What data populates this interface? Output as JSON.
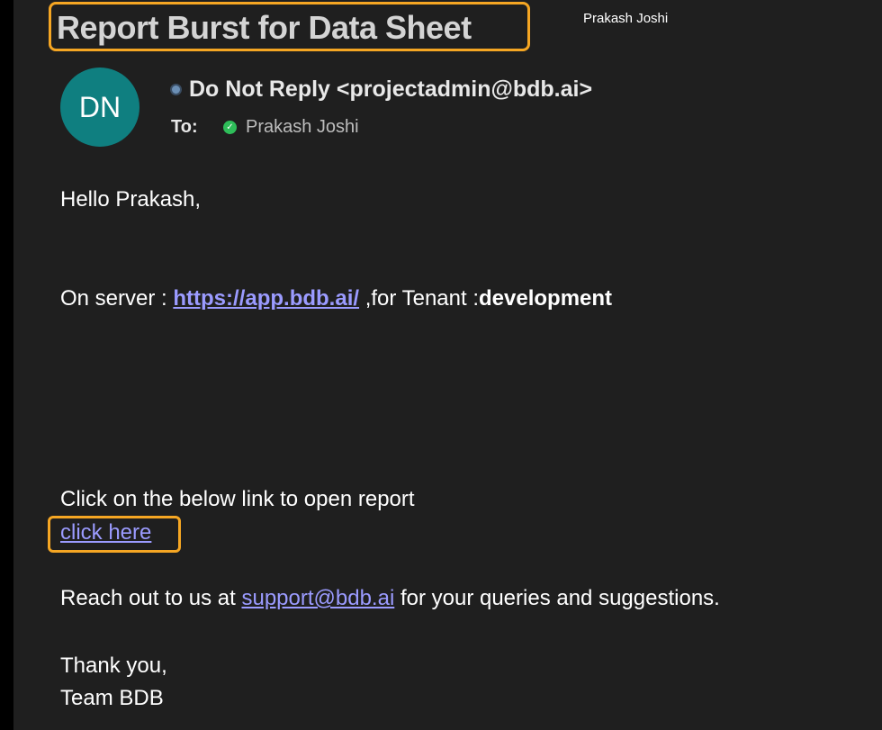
{
  "email": {
    "subject": "Report Burst for Data Sheet",
    "top_user": "Prakash Joshi",
    "avatar_initials": "DN",
    "from": "Do Not Reply <projectadmin@bdb.ai>",
    "to_label": "To:",
    "to_name": "Prakash Joshi"
  },
  "body": {
    "greeting": "Hello Prakash,",
    "server_prefix": "On server : ",
    "server_link": "https://app.bdb.ai/",
    "tenant_text": " ,for Tenant :",
    "tenant": "development",
    "link_intro": "Click on the below link to open report",
    "click_here": "click here",
    "reach_prefix": "Reach out to us at ",
    "support_email": "support@bdb.ai",
    "reach_suffix": " for your queries and suggestions.",
    "thanks": "Thank you,",
    "team": "Team BDB"
  }
}
